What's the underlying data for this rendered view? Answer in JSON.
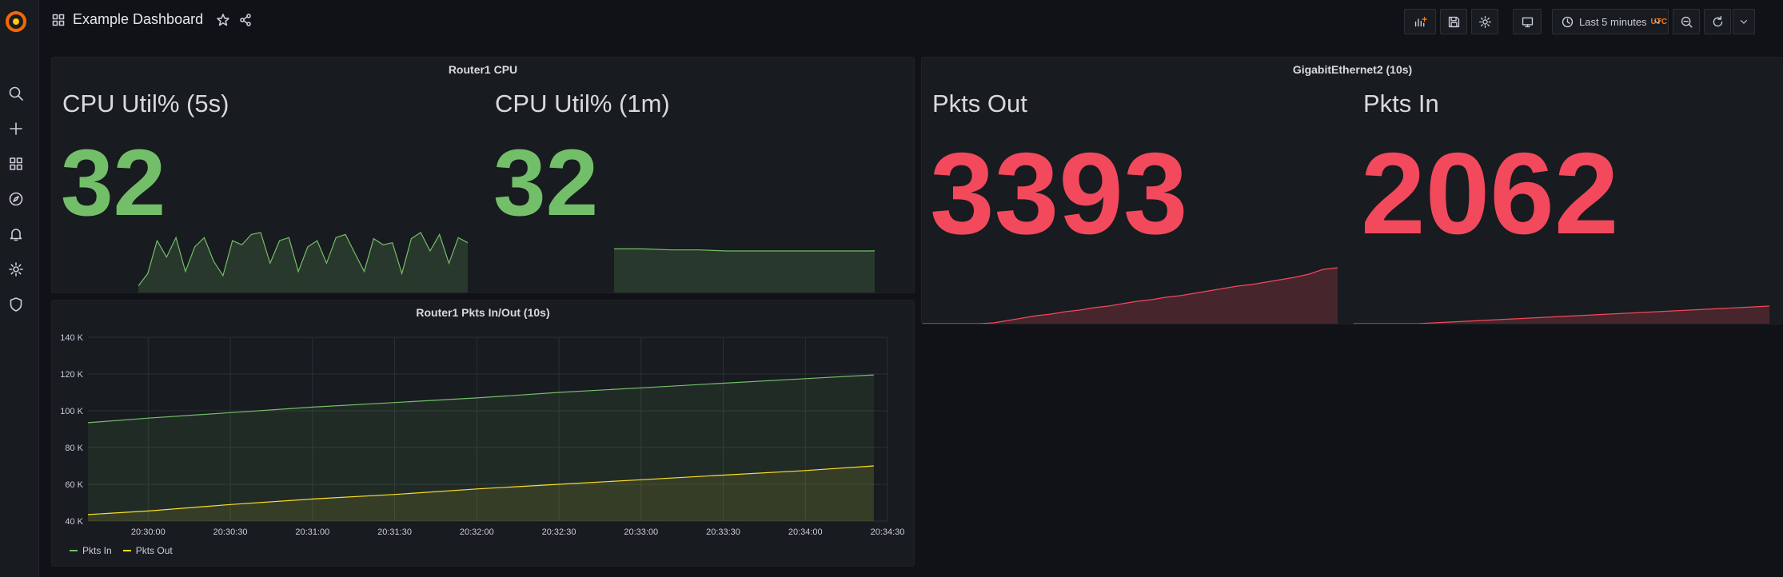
{
  "header": {
    "title": "Example Dashboard",
    "time_range": "Last 5 minutes",
    "timezone": "UTC"
  },
  "panels": {
    "router_cpu": {
      "title": "Router1 CPU",
      "stats": [
        {
          "name": "CPU Util% (5s)",
          "value": "32"
        },
        {
          "name": "CPU Util% (1m)",
          "value": "32"
        }
      ]
    },
    "gig2": {
      "title": "GigabitEthernet2 (10s)",
      "stats": [
        {
          "name": "Pkts Out",
          "value": "3393"
        },
        {
          "name": "Pkts In",
          "value": "2062"
        }
      ]
    },
    "pkts_chart": {
      "title": "Router1 Pkts In/Out (10s)"
    }
  },
  "colors": {
    "green": "#73bf69",
    "red": "#f2495c",
    "yellow": "#fade2a",
    "orange": "#ff780a"
  },
  "chart_data": {
    "type": "line",
    "title": "Router1 Pkts In/Out (10s)",
    "x_ticks": [
      "20:30:00",
      "20:30:30",
      "20:31:00",
      "20:31:30",
      "20:32:00",
      "20:32:30",
      "20:33:00",
      "20:33:30",
      "20:34:00",
      "20:34:30"
    ],
    "y_ticks": [
      "40 K",
      "60 K",
      "80 K",
      "100 K",
      "120 K",
      "140 K"
    ],
    "ylim": [
      40000,
      140000
    ],
    "xlim": [
      "20:29:38",
      "20:34:30"
    ],
    "grid": true,
    "legend_position": "bottom-left",
    "series": [
      {
        "name": "Pkts In",
        "color": "#73bf69",
        "x": [
          "20:29:38",
          "20:30:00",
          "20:30:30",
          "20:31:00",
          "20:31:30",
          "20:32:00",
          "20:32:30",
          "20:33:00",
          "20:33:30",
          "20:34:00",
          "20:34:25"
        ],
        "values": [
          93500,
          96000,
          99000,
          102000,
          104500,
          107000,
          110000,
          112500,
          115000,
          117500,
          119500
        ]
      },
      {
        "name": "Pkts Out",
        "color": "#fade2a",
        "x": [
          "20:29:38",
          "20:30:00",
          "20:30:30",
          "20:31:00",
          "20:31:30",
          "20:32:00",
          "20:32:30",
          "20:33:00",
          "20:33:30",
          "20:34:00",
          "20:34:25"
        ],
        "values": [
          43500,
          45500,
          49000,
          52000,
          54500,
          57500,
          60000,
          62500,
          65000,
          67500,
          70000
        ]
      }
    ]
  },
  "sparklines": {
    "cpu5s": [
      8,
      20,
      52,
      36,
      55,
      22,
      46,
      55,
      32,
      18,
      52,
      48,
      58,
      60,
      30,
      52,
      55,
      22,
      46,
      52,
      30,
      55,
      58,
      40,
      22,
      54,
      48,
      50,
      20,
      54,
      60,
      42,
      58,
      30,
      55,
      50
    ],
    "cpu1m": [
      44,
      44,
      43,
      43,
      42,
      42,
      42,
      42,
      42,
      42,
      43,
      43
    ],
    "pkts_out": [
      2,
      2,
      2,
      2,
      2,
      3,
      6,
      9,
      12,
      14,
      17,
      19,
      22,
      24,
      27,
      30,
      32,
      35,
      37,
      40,
      43,
      46,
      49,
      51,
      54,
      57,
      60,
      64,
      70,
      72
    ],
    "pkts_in": [
      2,
      2,
      2,
      2,
      2,
      3,
      4,
      5,
      6,
      7,
      8,
      9,
      10,
      11,
      12,
      13,
      14,
      15,
      16,
      17,
      18,
      19,
      20,
      21,
      22,
      23,
      24
    ]
  }
}
